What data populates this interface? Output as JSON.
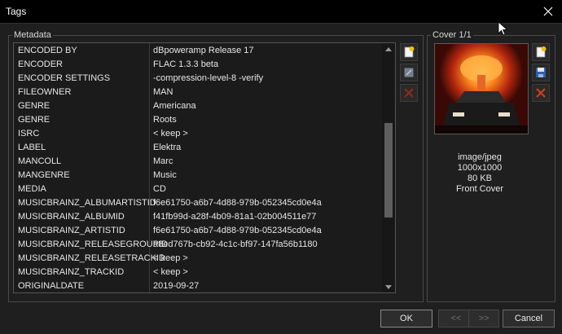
{
  "window": {
    "title": "Tags"
  },
  "metadata": {
    "group_label": "Metadata",
    "rows": [
      {
        "key": "ENCODED BY",
        "value": "dBpoweramp Release 17"
      },
      {
        "key": "ENCODER",
        "value": "FLAC 1.3.3 beta"
      },
      {
        "key": "ENCODER SETTINGS",
        "value": "-compression-level-8 -verify"
      },
      {
        "key": "FILEOWNER",
        "value": "MAN"
      },
      {
        "key": "GENRE",
        "value": "Americana"
      },
      {
        "key": "GENRE",
        "value": " Roots"
      },
      {
        "key": "ISRC",
        "value": "< keep >"
      },
      {
        "key": "LABEL",
        "value": "Elektra"
      },
      {
        "key": "MANCOLL",
        "value": "Marc"
      },
      {
        "key": "MANGENRE",
        "value": "Music"
      },
      {
        "key": "MEDIA",
        "value": "CD"
      },
      {
        "key": "MUSICBRAINZ_ALBUMARTISTID",
        "value": "f6e61750-a6b7-4d88-979b-052345cd0e4a"
      },
      {
        "key": "MUSICBRAINZ_ALBUMID",
        "value": "f41fb99d-a28f-4b09-81a1-02b004511e77"
      },
      {
        "key": "MUSICBRAINZ_ARTISTID",
        "value": "f6e61750-a6b7-4d88-979b-052345cd0e4a"
      },
      {
        "key": "MUSICBRAINZ_RELEASEGROUPID",
        "value": "a8ed767b-cb92-4c1c-bf97-147fa56b1180"
      },
      {
        "key": "MUSICBRAINZ_RELEASETRACKID",
        "value": "< keep >"
      },
      {
        "key": "MUSICBRAINZ_TRACKID",
        "value": "< keep >"
      },
      {
        "key": "ORIGINALDATE",
        "value": "2019-09-27"
      }
    ]
  },
  "cover": {
    "group_label": "Cover 1/1",
    "mime": "image/jpeg",
    "dimensions": "1000x1000",
    "size": "80 KB",
    "type": "Front Cover"
  },
  "buttons": {
    "ok": "OK",
    "prev": "<<",
    "next": ">>",
    "cancel": "Cancel"
  },
  "colors": {
    "add_icon": "#f2c200",
    "remove_icon": "#d63a1c",
    "save_icon": "#2f5fb3"
  }
}
